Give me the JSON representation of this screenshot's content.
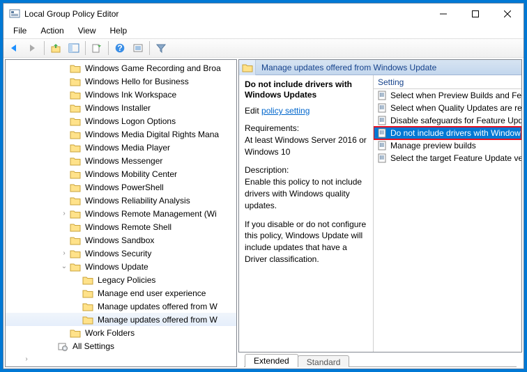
{
  "titlebar": {
    "title": "Local Group Policy Editor"
  },
  "menus": {
    "file": "File",
    "action": "Action",
    "view": "View",
    "help": "Help"
  },
  "tree": {
    "items": [
      {
        "indent": 4,
        "label": "Windows Game Recording and Broa"
      },
      {
        "indent": 4,
        "label": "Windows Hello for Business"
      },
      {
        "indent": 4,
        "label": "Windows Ink Workspace"
      },
      {
        "indent": 4,
        "label": "Windows Installer"
      },
      {
        "indent": 4,
        "label": "Windows Logon Options"
      },
      {
        "indent": 4,
        "label": "Windows Media Digital Rights Mana"
      },
      {
        "indent": 4,
        "label": "Windows Media Player"
      },
      {
        "indent": 4,
        "label": "Windows Messenger"
      },
      {
        "indent": 4,
        "label": "Windows Mobility Center"
      },
      {
        "indent": 4,
        "label": "Windows PowerShell"
      },
      {
        "indent": 4,
        "label": "Windows Reliability Analysis"
      },
      {
        "indent": 4,
        "label": "Windows Remote Management (Wi",
        "expander": "right"
      },
      {
        "indent": 4,
        "label": "Windows Remote Shell"
      },
      {
        "indent": 4,
        "label": "Windows Sandbox"
      },
      {
        "indent": 4,
        "label": "Windows Security",
        "expander": "right"
      },
      {
        "indent": 4,
        "label": "Windows Update",
        "expander": "down"
      },
      {
        "indent": 5,
        "label": "Legacy Policies"
      },
      {
        "indent": 5,
        "label": "Manage end user experience"
      },
      {
        "indent": 5,
        "label": "Manage updates offered from W"
      },
      {
        "indent": 5,
        "label": "Manage updates offered from W",
        "selected": true
      },
      {
        "indent": 4,
        "label": "Work Folders"
      },
      {
        "indent": 3,
        "label": "All Settings",
        "icontype": "gear"
      },
      {
        "indent": 1,
        "label": "",
        "cut": true
      }
    ]
  },
  "header": {
    "title": "Manage updates offered from Windows Update"
  },
  "detail": {
    "title": "Do not include drivers with Windows Updates",
    "edit_text": "Edit ",
    "link": "policy setting ",
    "req_label": "Requirements:",
    "req_text": "At least Windows Server 2016 or Windows 10",
    "desc_label": "Description:",
    "desc_text": "Enable this policy to not include drivers with Windows quality updates.",
    "desc_text2": "If you disable or do not configure this policy, Windows Update will include updates that have a Driver classification."
  },
  "list": {
    "header": "Setting",
    "rows": [
      {
        "label": "Select when Preview Builds and Feature"
      },
      {
        "label": "Select when Quality Updates are receiv"
      },
      {
        "label": "Disable safeguards for Feature Updates"
      },
      {
        "label": "Do not include drivers with Windows U",
        "selected": true
      },
      {
        "label": "Manage preview builds"
      },
      {
        "label": "Select the target Feature Update versio"
      }
    ]
  },
  "tabs": {
    "extended": "Extended",
    "standard": "Standard"
  }
}
